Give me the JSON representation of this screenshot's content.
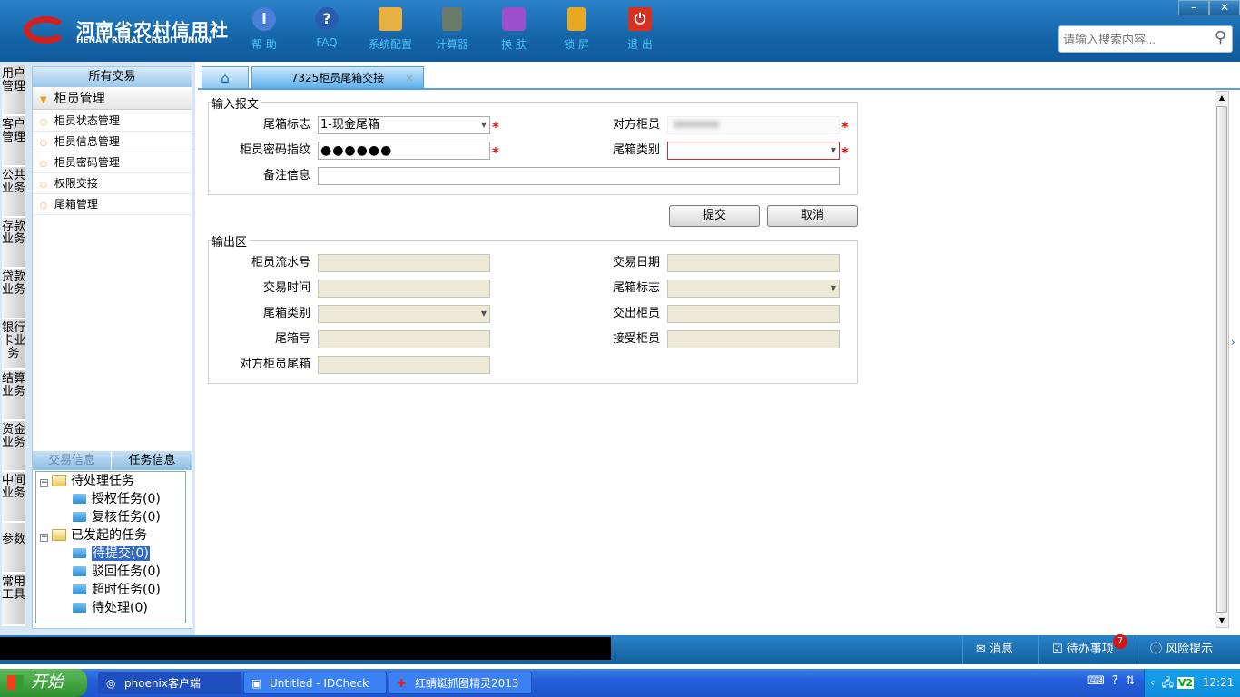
{
  "header": {
    "logo_cn": "河南省农村信用社",
    "logo_en": "HENAN RURAL CREDIT UNION",
    "tools": [
      {
        "label": "帮 助",
        "icon": "info-icon",
        "color": "#4a7fd8"
      },
      {
        "label": "FAQ",
        "icon": "question-icon",
        "color": "#2a5cb0"
      },
      {
        "label": "系统配置",
        "icon": "toolbox-icon",
        "color": "#e8b040"
      },
      {
        "label": "计算器",
        "icon": "calculator-icon",
        "color": "#6a7a6a"
      },
      {
        "label": "换 肤",
        "icon": "shirt-icon",
        "color": "#9c4fc8"
      },
      {
        "label": "锁 屏",
        "icon": "lock-icon",
        "color": "#e8a820"
      },
      {
        "label": "退 出",
        "icon": "power-icon",
        "color": "#d83020"
      }
    ],
    "search_placeholder": "请输入搜索内容..."
  },
  "side_tabs": [
    "用户管理",
    "客户管理",
    "公共业务",
    "存款业务",
    "贷款业务",
    "银行卡业务",
    "结算业务",
    "资金业务",
    "中间业务",
    "参数",
    "常用工具"
  ],
  "left_panel": {
    "title": "所有交易",
    "group": "柜员管理",
    "items": [
      "柜员状态管理",
      "柜员信息管理",
      "柜员密码管理",
      "权限交接",
      "尾箱管理"
    ],
    "bottom_tabs": [
      "交易信息",
      "任务信息"
    ],
    "tree": {
      "pending": "待处理任务",
      "pending_children": [
        "授权任务(0)",
        "复核任务(0)"
      ],
      "initiated": "已发起的任务",
      "initiated_children": [
        "待提交(0)",
        "驳回任务(0)",
        "超时任务(0)",
        "待处理(0)"
      ]
    }
  },
  "tabs": {
    "active": "7325柜员尾箱交接",
    "close": "×"
  },
  "input_section": {
    "legend": "输入报文",
    "box_flag_label": "尾箱标志",
    "box_flag_value": "1-现金尾箱",
    "other_teller_label": "对方柜员",
    "other_teller_value": "",
    "password_label": "柜员密码指纹",
    "password_value": "●●●●●●",
    "box_type_label": "尾箱类别",
    "box_type_value": "",
    "remark_label": "备注信息",
    "remark_value": "",
    "required": "*"
  },
  "buttons": {
    "submit": "提交",
    "cancel": "取消"
  },
  "output_section": {
    "legend": "输出区",
    "fields": [
      {
        "label": "柜员流水号",
        "dropdown": false
      },
      {
        "label": "交易日期",
        "dropdown": false
      },
      {
        "label": "交易时间",
        "dropdown": false
      },
      {
        "label": "尾箱标志",
        "dropdown": true
      },
      {
        "label": "尾箱类别",
        "dropdown": true
      },
      {
        "label": "交出柜员",
        "dropdown": false
      },
      {
        "label": "尾箱号",
        "dropdown": false
      },
      {
        "label": "接受柜员",
        "dropdown": false
      },
      {
        "label": "对方柜员尾箱",
        "dropdown": false
      }
    ]
  },
  "statusbar": {
    "messages": "消息",
    "todo": "待办事项",
    "todo_badge": "7",
    "risk": "风险提示"
  },
  "taskbar": {
    "start": "开始",
    "tasks": [
      "phoenix客户端",
      "Untitled - IDCheck",
      "红蜻蜓抓图精灵2013"
    ],
    "clock": "12:21"
  }
}
